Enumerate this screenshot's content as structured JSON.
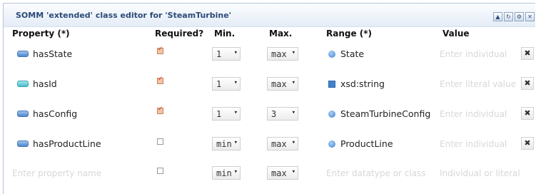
{
  "editor": {
    "title": "SOMM 'extended' class editor for 'SteamTurbine'",
    "window_buttons": [
      "collapse-icon",
      "refresh-icon",
      "gear-icon",
      "close-icon"
    ]
  },
  "columns": {
    "property": "Property (*)",
    "required": "Required?",
    "min": "Min.",
    "max": "Max.",
    "range": "Range (*)",
    "value": "Value"
  },
  "rows": [
    {
      "property": "hasState",
      "property_icon": "object-property-icon",
      "required": true,
      "min": "1",
      "max": "max",
      "range": "State",
      "range_icon": "class-icon",
      "value_placeholder": "Enter individual",
      "remove_glyph": "✖"
    },
    {
      "property": "hasId",
      "property_icon": "datatype-property-icon",
      "required": true,
      "min": "1",
      "max": "max",
      "range": "xsd:string",
      "range_icon": "datatype-icon",
      "value_placeholder": "Enter literal value",
      "remove_glyph": "✖"
    },
    {
      "property": "hasConfig",
      "property_icon": "object-property-icon",
      "required": true,
      "min": "1",
      "max": "3",
      "range": "SteamTurbineConfig",
      "range_icon": "class-icon",
      "value_placeholder": "Enter individual",
      "remove_glyph": "✖"
    },
    {
      "property": "hasProductLine",
      "property_icon": "object-property-icon",
      "required": false,
      "min": "min",
      "max": "max",
      "range": "ProductLine",
      "range_icon": "class-icon",
      "value_placeholder": "Enter individual",
      "remove_glyph": "✖"
    }
  ],
  "new_row": {
    "property_placeholder": "Enter property name",
    "required": false,
    "min": "min",
    "max": "max",
    "range_placeholder": "Enter datatype or class",
    "value_placeholder": "Individual or literal"
  },
  "colors": {
    "title": "#2b4a78",
    "placeholder": "#d7d7d7",
    "checked": "#c43a12"
  }
}
